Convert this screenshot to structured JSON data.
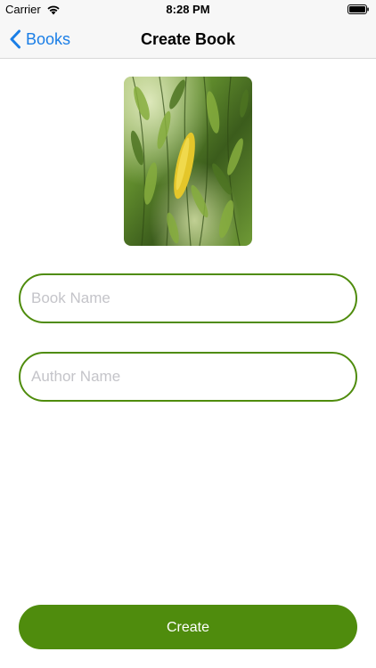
{
  "status_bar": {
    "carrier": "Carrier",
    "time": "8:28 PM",
    "icons": [
      "wifi-icon",
      "battery-icon"
    ]
  },
  "nav": {
    "back_label": "Books",
    "back_icon": "chevron-left-icon",
    "title": "Create Book"
  },
  "cover": {
    "description_icon": "book-cover-image"
  },
  "form": {
    "book_name": {
      "value": "",
      "placeholder": "Book Name"
    },
    "author_name": {
      "value": "",
      "placeholder": "Author Name"
    }
  },
  "actions": {
    "create_label": "Create"
  },
  "colors": {
    "accent": "#4f8c0d",
    "link": "#1a7ee6",
    "placeholder": "#c4c4c9",
    "bar_background": "#f7f7f7"
  }
}
